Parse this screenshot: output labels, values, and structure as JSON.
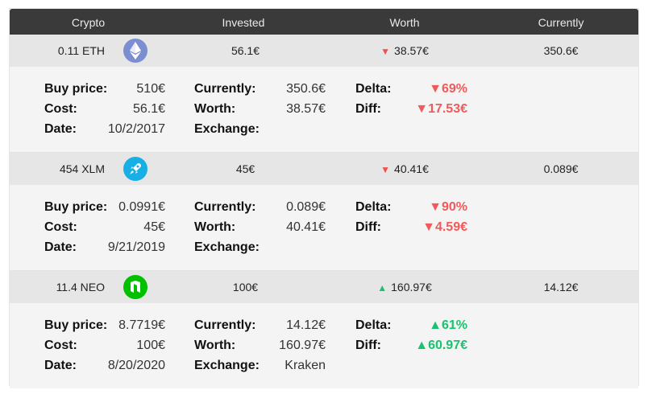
{
  "header": {
    "crypto": "Crypto",
    "invested": "Invested",
    "worth": "Worth",
    "currently": "Currently"
  },
  "labels": {
    "buy_price": "Buy price:",
    "cost": "Cost:",
    "date": "Date:",
    "currently": "Currently:",
    "worth": "Worth:",
    "exchange": "Exchange:",
    "delta": "Delta:",
    "diff": "Diff:"
  },
  "coins": [
    {
      "amount": "0.11 ETH",
      "icon": "ethereum-icon",
      "color": "#7b8fd0",
      "invested": "56.1€",
      "worth": "38.57€",
      "trend": "down",
      "currently": "350.6€",
      "buy_price": "510€",
      "cost": "56.1€",
      "date": "10/2/2017",
      "cur_detail": "350.6€",
      "worth_detail": "38.57€",
      "exchange": "",
      "delta": "69%",
      "diff": "17.53€"
    },
    {
      "amount": "454 XLM",
      "icon": "rocket-icon",
      "color": "#18aee6",
      "invested": "45€",
      "worth": "40.41€",
      "trend": "down",
      "currently": "0.089€",
      "buy_price": "0.0991€",
      "cost": "45€",
      "date": "9/21/2019",
      "cur_detail": "0.089€",
      "worth_detail": "40.41€",
      "exchange": "",
      "delta": "90%",
      "diff": "4.59€"
    },
    {
      "amount": "11.4 NEO",
      "icon": "neo-icon",
      "color": "#00c000",
      "invested": "100€",
      "worth": "160.97€",
      "trend": "up",
      "currently": "14.12€",
      "buy_price": "8.7719€",
      "cost": "100€",
      "date": "8/20/2020",
      "cur_detail": "14.12€",
      "worth_detail": "160.97€",
      "exchange": "Kraken",
      "delta": "61%",
      "diff": "60.97€"
    }
  ]
}
